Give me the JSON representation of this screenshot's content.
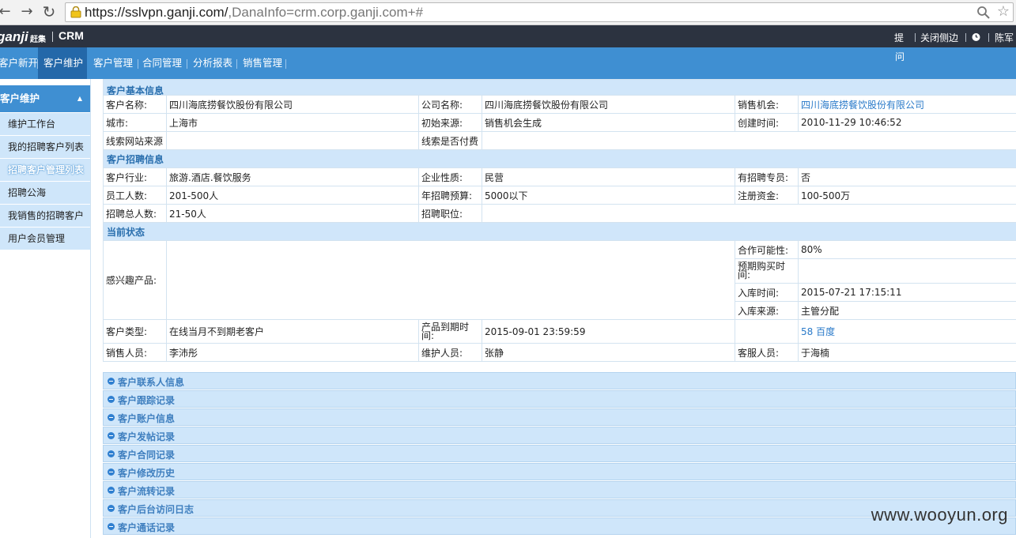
{
  "browser": {
    "url_host": "https://sslvpn.ganji.com/",
    "url_rest": ",DanaInfo=crm.corp.ganji.com+#"
  },
  "header": {
    "logo": "ganji",
    "logo_cn": "赶集",
    "title": "CRM",
    "links": {
      "tip": "提",
      "collapse": "关闭侧边",
      "user": "陈军"
    }
  },
  "nav": {
    "tabs": [
      "客户新开",
      "客户维护",
      "客户管理",
      "合同管理",
      "分析报表",
      "销售管理"
    ],
    "tip_line2": "问"
  },
  "sidebar": {
    "title": "客户维护",
    "items": [
      "维护工作台",
      "我的招聘客户列表",
      "招聘客户管理列表",
      "招聘公海",
      "我销售的招聘客户",
      "用户会员管理"
    ]
  },
  "sections": {
    "basic": "客户基本信息",
    "recruit": "客户招聘信息",
    "status": "当前状态"
  },
  "basic": {
    "customer_name_label": "客户名称:",
    "customer_name": "四川海底捞餐饮股份有限公司",
    "company_name_label": "公司名称:",
    "company_name": "四川海底捞餐饮股份有限公司",
    "sales_chance_label": "销售机会:",
    "sales_chance": "四川海底捞餐饮股份有限公司",
    "city_label": "城市:",
    "city": "上海市",
    "source_label": "初始来源:",
    "source": "销售机会生成",
    "created_label": "创建时间:",
    "created": "2010-11-29 10:46:52",
    "lead_site_label": "线索网站来源",
    "lead_paid_label": "线索是否付费"
  },
  "recruit": {
    "industry_label": "客户行业:",
    "industry": "旅游.酒店.餐饮服务",
    "nature_label": "企业性质:",
    "nature": "民营",
    "specialist_label": "有招聘专员:",
    "specialist": "否",
    "employees_label": "员工人数:",
    "employees": "201-500人",
    "budget_label": "年招聘预算:",
    "budget": "5000以下",
    "capital_label": "注册资金:",
    "capital": "100-500万",
    "total_label": "招聘总人数:",
    "total": "21-50人",
    "position_label": "招聘职位:"
  },
  "status": {
    "interest_label": "感兴趣产品:",
    "possibility_label": "合作可能性:",
    "possibility": "80%",
    "expect_buy_label": "预期购买时间:",
    "storage_time_label": "入库时间:",
    "storage_time": "2015-07-21 17:15:11",
    "storage_source_label": "入库来源:",
    "storage_source": "主管分配",
    "type_label": "客户类型:",
    "type": "在线当月不到期老客户",
    "expire_label": "产品到期时间:",
    "expire": "2015-09-01 23:59:59",
    "product_links": "58 百度",
    "sales_label": "销售人员:",
    "sales": "李沛彤",
    "maintainer_label": "维护人员:",
    "maintainer": "张静",
    "service_label": "客服人员:",
    "service": "于海楠"
  },
  "panels": [
    "客户联系人信息",
    "客户跟踪记录",
    "客户账户信息",
    "客户发帖记录",
    "客户合同记录",
    "客户修改历史",
    "客户流转记录",
    "客户后台访问日志",
    "客户通话记录"
  ],
  "watermark": "www.wooyun.org",
  "colors": {
    "nav_blue": "#3f8fd2",
    "nav_active": "#2468a9",
    "header_dark": "#2c3340",
    "section_bg": "#d0e6fa",
    "link_blue": "#2a7ac9"
  }
}
